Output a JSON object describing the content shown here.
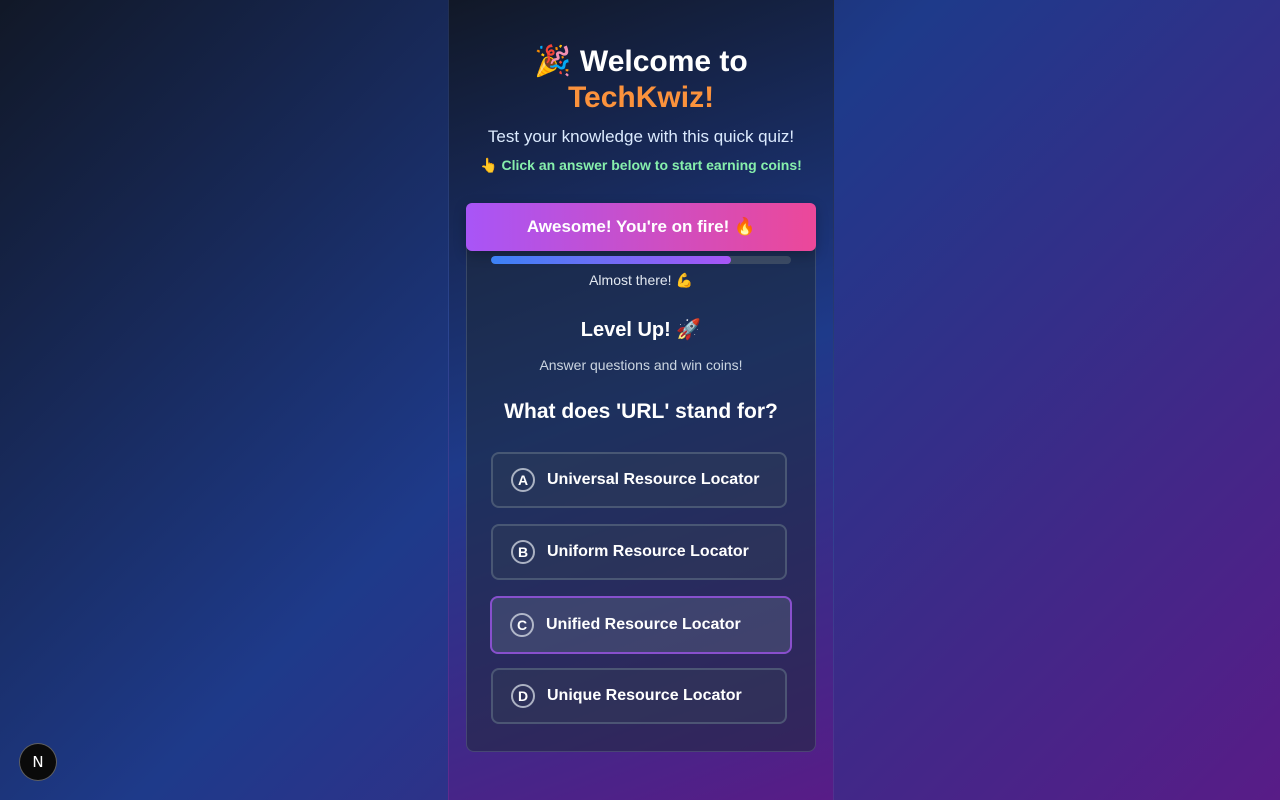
{
  "header": {
    "title_prefix": "🎉 Welcome to",
    "brand": "TechKwiz!",
    "subtitle": "Test your knowledge with this quick quiz!",
    "hint": "👆 Click an answer below to start earning coins!"
  },
  "banner": {
    "text": "Awesome! You're on fire! 🔥"
  },
  "progress": {
    "fraction": 0.8,
    "label": "Almost there! 💪"
  },
  "level": {
    "title": "Level Up! 🚀",
    "subtitle": "Answer questions and win coins!"
  },
  "quiz": {
    "question": "What does 'URL' stand for?",
    "options": [
      {
        "letter": "A",
        "text": "Universal Resource Locator"
      },
      {
        "letter": "B",
        "text": "Uniform Resource Locator"
      },
      {
        "letter": "C",
        "text": "Unified Resource Locator"
      },
      {
        "letter": "D",
        "text": "Unique Resource Locator"
      }
    ]
  },
  "badge": {
    "label": "N"
  },
  "colors": {
    "brand": "#fb923c",
    "hint": "#86efac",
    "banner_start": "#a855f7",
    "banner_end": "#ec4899"
  }
}
